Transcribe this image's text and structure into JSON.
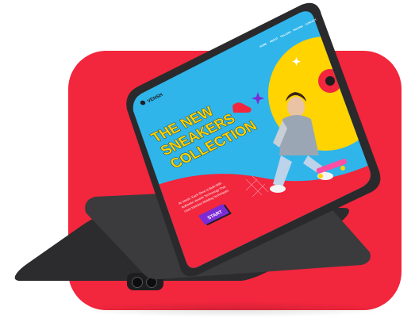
{
  "brand": {
    "name": "VENSH"
  },
  "nav": {
    "items": [
      "HOME",
      "ABOUT",
      "GALLERY",
      "PRICING",
      "CONTACT"
    ]
  },
  "hero": {
    "title_line1": "THE NEW",
    "title_line2": "SNEAKERS",
    "title_line3": "COLLECTION",
    "description_line1": "At Vensh, Each Shoe Is Built With",
    "description_line2": "Authentic Venesh Technology That",
    "description_line3": "Uses Injection Molding Techniques.",
    "cta_label": "START"
  },
  "badge": {
    "text": "THE NEW SNEAKERS COLLECTION"
  },
  "colors": {
    "accent_red": "#f2263d",
    "sky_blue": "#2fb5ea",
    "yellow": "#ffd400",
    "purple": "#7b2bd6",
    "tablet_frame": "#2a2a2c"
  }
}
